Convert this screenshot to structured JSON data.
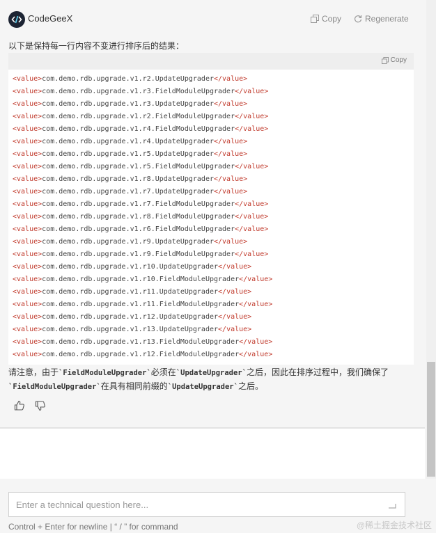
{
  "header": {
    "brand": "CodeGeeX",
    "copy_label": "Copy",
    "regenerate_label": "Regenerate"
  },
  "message": {
    "intro": "以下是保持每一行内容不变进行排序后的结果：",
    "code_copy_label": "Copy",
    "code_lines": [
      "com.demo.rdb.upgrade.v1.r2.UpdateUpgrader",
      "com.demo.rdb.upgrade.v1.r3.FieldModuleUpgrader",
      "com.demo.rdb.upgrade.v1.r3.UpdateUpgrader",
      "com.demo.rdb.upgrade.v1.r2.FieldModuleUpgrader",
      "com.demo.rdb.upgrade.v1.r4.FieldModuleUpgrader",
      "com.demo.rdb.upgrade.v1.r4.UpdateUpgrader",
      "com.demo.rdb.upgrade.v1.r5.UpdateUpgrader",
      "com.demo.rdb.upgrade.v1.r5.FieldModuleUpgrader",
      "com.demo.rdb.upgrade.v1.r8.UpdateUpgrader",
      "com.demo.rdb.upgrade.v1.r7.UpdateUpgrader",
      "com.demo.rdb.upgrade.v1.r7.FieldModuleUpgrader",
      "com.demo.rdb.upgrade.v1.r8.FieldModuleUpgrader",
      "com.demo.rdb.upgrade.v1.r6.FieldModuleUpgrader",
      "com.demo.rdb.upgrade.v1.r9.UpdateUpgrader",
      "com.demo.rdb.upgrade.v1.r9.FieldModuleUpgrader",
      "com.demo.rdb.upgrade.v1.r10.UpdateUpgrader",
      "com.demo.rdb.upgrade.v1.r10.FieldModuleUpgrader",
      "com.demo.rdb.upgrade.v1.r11.UpdateUpgrader",
      "com.demo.rdb.upgrade.v1.r11.FieldModuleUpgrader",
      "com.demo.rdb.upgrade.v1.r12.UpdateUpgrader",
      "com.demo.rdb.upgrade.v1.r13.UpdateUpgrader",
      "com.demo.rdb.upgrade.v1.r13.FieldModuleUpgrader",
      "com.demo.rdb.upgrade.v1.r12.FieldModuleUpgrader"
    ],
    "note": {
      "p1": "请注意，由于",
      "c1": "`FieldModuleUpgrader`",
      "p2": "必须在",
      "c2": "`UpdateUpgrader`",
      "p3": "之后，因此在排序过程中，我们确保了",
      "c3": "`FieldModuleUpgrader`",
      "p4": "在具有相同前缀的",
      "c4": "`UpdateUpgrader`",
      "p5": "之后。"
    }
  },
  "input": {
    "placeholder": "Enter a technical question here...",
    "hint": "Control + Enter for newline | “ / ” for command"
  },
  "watermark": "@稀土掘金技术社区",
  "colors": {
    "tag": "#c0392b",
    "code_text": "#444444",
    "logo_bg": "#1d2433"
  }
}
